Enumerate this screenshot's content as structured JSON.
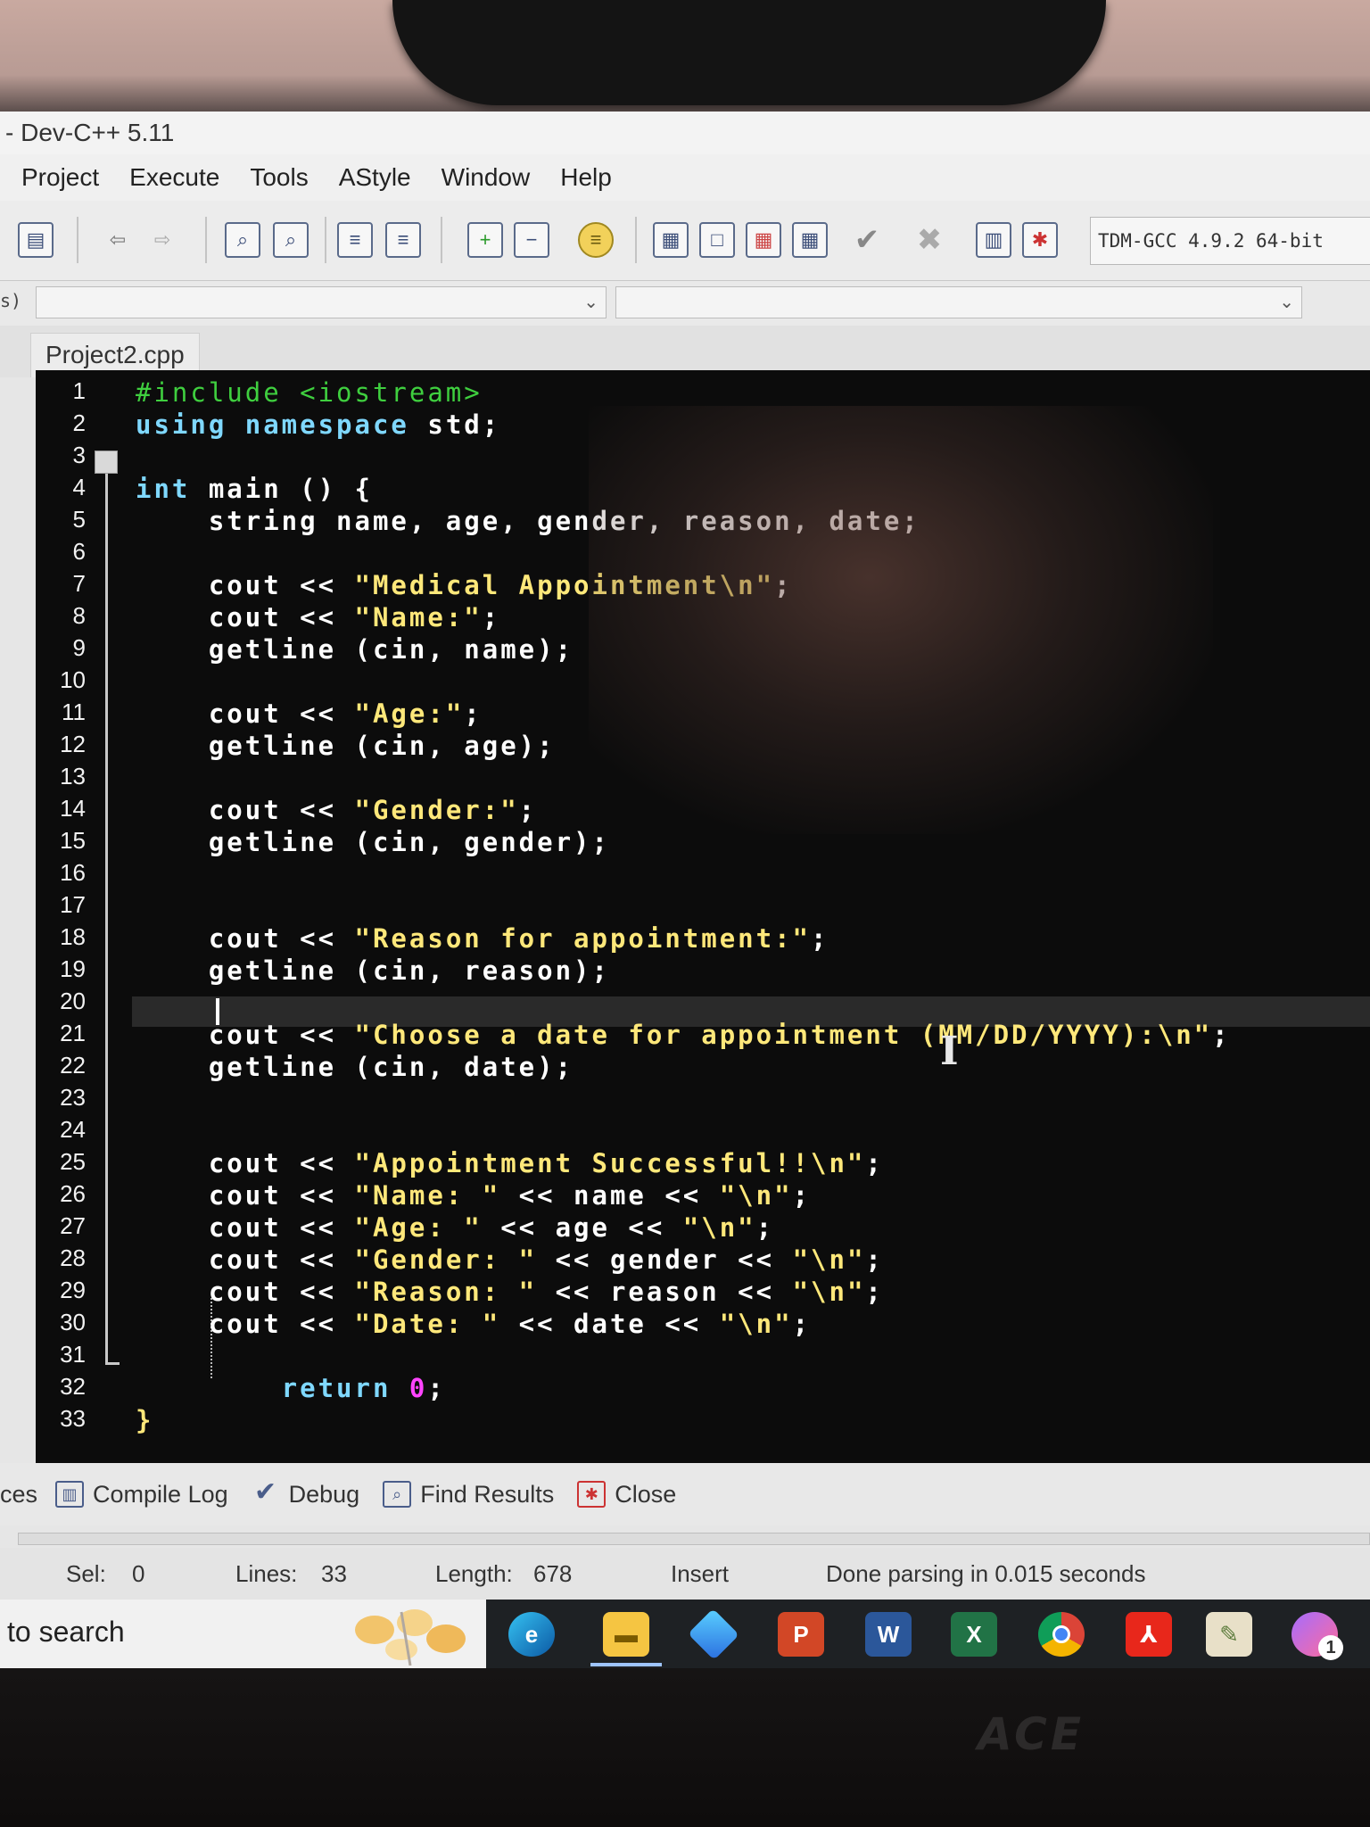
{
  "window": {
    "title": "- Dev-C++ 5.11"
  },
  "menu": [
    "Project",
    "Execute",
    "Tools",
    "AStyle",
    "Window",
    "Help"
  ],
  "toolbar": {
    "compiler": "TDM-GCC 4.9.2 64-bit"
  },
  "left_clip_label": "s)",
  "tab": {
    "file": "Project2.cpp"
  },
  "editor": {
    "line_numbers": [
      "1",
      "2",
      "3",
      "4",
      "5",
      "6",
      "7",
      "8",
      "9",
      "10",
      "11",
      "12",
      "13",
      "14",
      "15",
      "16",
      "17",
      "18",
      "19",
      "20",
      "21",
      "22",
      "23",
      "24",
      "25",
      "26",
      "27",
      "28",
      "29",
      "30",
      "31",
      "32",
      "33"
    ],
    "lines": {
      "l1": "#include <iostream>",
      "l2_kw": "using namespace",
      "l2_rest": " std;",
      "l4_kw": "int",
      "l4_rest": " main () {",
      "l5": "    string name, age, gender, reason, date;",
      "l7_a": "    cout << ",
      "l7_s": "\"Medical Appointment\\n\"",
      "l7_b": ";",
      "l8_a": "    cout << ",
      "l8_s": "\"Name:\"",
      "l8_b": ";",
      "l9": "    getline (cin, name);",
      "l11_a": "    cout << ",
      "l11_s": "\"Age:\"",
      "l11_b": ";",
      "l12": "    getline (cin, age);",
      "l14_a": "    cout << ",
      "l14_s": "\"Gender:\"",
      "l14_b": ";",
      "l15": "    getline (cin, gender);",
      "l17_a": "    cout << ",
      "l17_s": "\"Reason for appointment:\"",
      "l17_b": ";",
      "l18": "    getline (cin, reason);",
      "l20_a": "    cout << ",
      "l20_s": "\"Choose a date for appointment (MM/DD/YYYY):\\n\"",
      "l20_b": ";",
      "l21": "    getline (cin, date);",
      "l24_a": "    cout << ",
      "l24_s": "\"Appointment Successful!!\\n\"",
      "l24_b": ";",
      "l25_a": "    cout << ",
      "l25_s": "\"Name: \"",
      "l25_b": " << name << ",
      "l25_s2": "\"\\n\"",
      "l25_c": ";",
      "l26_a": "    cout << ",
      "l26_s": "\"Age: \"",
      "l26_b": " << age << ",
      "l26_s2": "\"\\n\"",
      "l26_c": ";",
      "l27_a": "    cout << ",
      "l27_s": "\"Gender: \"",
      "l27_b": " << gender << ",
      "l27_s2": "\"\\n\"",
      "l27_c": ";",
      "l28_a": "    cout << ",
      "l28_s": "\"Reason: \"",
      "l28_b": " << reason << ",
      "l28_s2": "\"\\n\"",
      "l28_c": ";",
      "l29_a": "    cout << ",
      "l29_s": "\"Date: \"",
      "l29_b": " << date << ",
      "l29_s2": "\"\\n\"",
      "l29_c": ";",
      "l31_kw": "        return",
      "l31_sp": " ",
      "l31_num": "0",
      "l31_b": ";",
      "l33": "}"
    }
  },
  "bottom_tabs": {
    "clip": "ces",
    "compile_log": "Compile Log",
    "debug": "Debug",
    "find_results": "Find Results",
    "close": "Close"
  },
  "status": {
    "sel_label": "Sel:",
    "sel_value": "0",
    "lines_label": "Lines:",
    "lines_value": "33",
    "length_label": "Length:",
    "length_value": "678",
    "mode": "Insert",
    "message": "Done parsing in 0.015 seconds"
  },
  "taskbar": {
    "search_text": "to search",
    "apps": [
      "edge-icon",
      "file-explorer-icon",
      "copilot-icon",
      "powerpoint-icon",
      "word-icon",
      "excel-icon",
      "chrome-icon",
      "acrobat-icon",
      "notepad-icon",
      "messenger-icon"
    ],
    "badge": "1"
  },
  "monitor_brand": "ACE",
  "colors": {
    "editor_bg": "#0c0c0c",
    "preprocessor": "#3fcf3f",
    "keyword": "#7fd8ff",
    "string": "#ffe87a",
    "number": "#ff44ff"
  }
}
